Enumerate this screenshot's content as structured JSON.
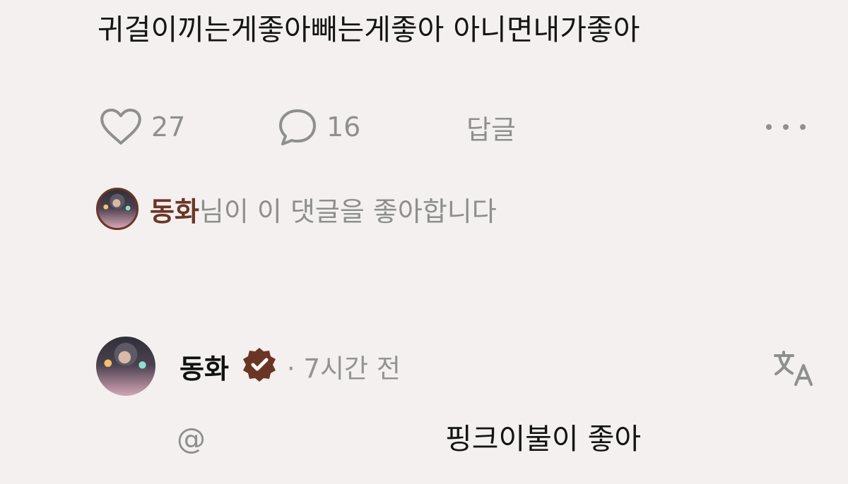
{
  "comment": {
    "text": "귀걸이끼는게좋아빼는게좋아 아니면내가좋아"
  },
  "actions": {
    "likes_count": "27",
    "replies_count": "16",
    "reply_label": "답글"
  },
  "liked_by": {
    "name": "동화",
    "suffix": "님이 이 댓글을 좋아합니다"
  },
  "reply": {
    "author": "동화",
    "time": "· 7시간 전",
    "mention": "@",
    "text": "핑크이불이 좋아"
  },
  "colors": {
    "background": "#f3f0ef",
    "accent_brown": "#6b3526",
    "muted_gray": "#8f8f8f"
  },
  "icons": {
    "like": "heart-icon",
    "reply_count": "comment-bubble-icon",
    "more": "more-dots-icon",
    "verified": "verified-badge-icon",
    "translate": "translate-icon"
  }
}
